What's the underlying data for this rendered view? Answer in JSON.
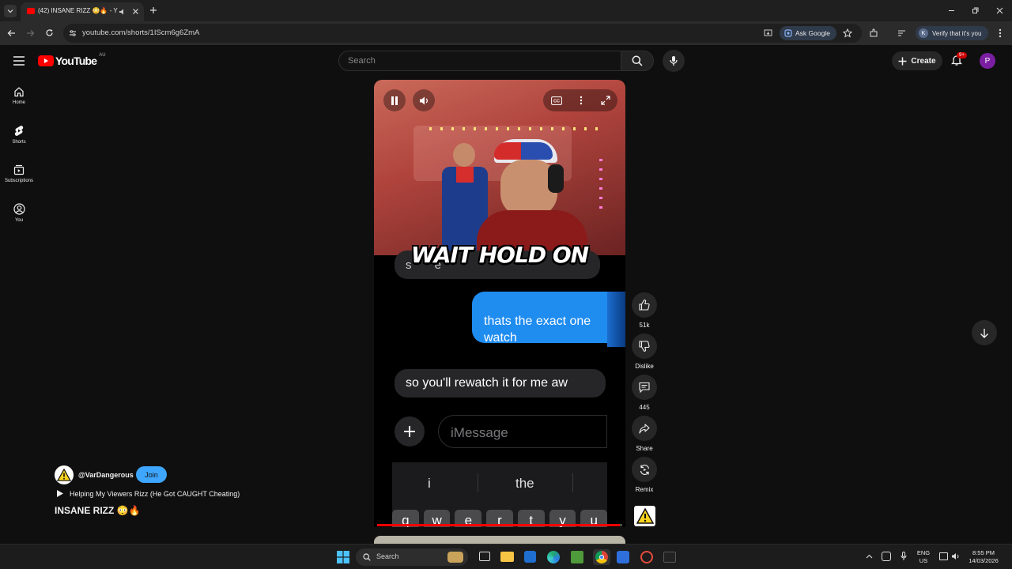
{
  "browser": {
    "tab_title": "(42) INSANE RIZZ 😳🔥 - Y",
    "url": "youtube.com/shorts/1IScm6g6ZmA",
    "ask_google": "Ask Google",
    "verify": "Verify that it's you",
    "profile_initial": "K"
  },
  "youtube": {
    "logo_text": "YouTube",
    "region": "AU",
    "search_placeholder": "Search",
    "create_label": "Create",
    "notif_badge": "9+",
    "avatar_initial": "P"
  },
  "sidebar": {
    "items": [
      {
        "label": "Home",
        "icon": "home-icon"
      },
      {
        "label": "Shorts",
        "icon": "shorts-icon"
      },
      {
        "label": "Subscriptions",
        "icon": "subscriptions-icon"
      },
      {
        "label": "You",
        "icon": "you-icon"
      }
    ]
  },
  "video": {
    "caption": "WAIT HOLD ON",
    "chat": {
      "partial_top": "s       e",
      "sent_message": "thats the exact one\nwatch",
      "received_message": "so you'll rewatch it for me aw",
      "input_placeholder": "iMessage",
      "suggestions": [
        "i",
        "the"
      ],
      "keys": [
        "q",
        "w",
        "e",
        "r",
        "t",
        "y",
        "u"
      ]
    },
    "progress": 0.99
  },
  "actions": {
    "like_count": "51k",
    "dislike_label": "Dislike",
    "comment_count": "445",
    "share_label": "Share",
    "remix_label": "Remix"
  },
  "channel": {
    "handle": "@VarDangerous",
    "join_label": "Join",
    "playlist": "Helping My Viewers Rizz (He Got CAUGHT Cheating)",
    "title": "INSANE RIZZ 😳🔥"
  },
  "taskbar": {
    "search_placeholder": "Search",
    "lang_top": "ENG",
    "lang_bottom": "US",
    "time": "8:55 PM",
    "date": "14/03/2026"
  },
  "colors": {
    "accent_blue": "#3ea6ff",
    "youtube_red": "#ff0000",
    "imessage_blue": "#1f8cf0"
  }
}
